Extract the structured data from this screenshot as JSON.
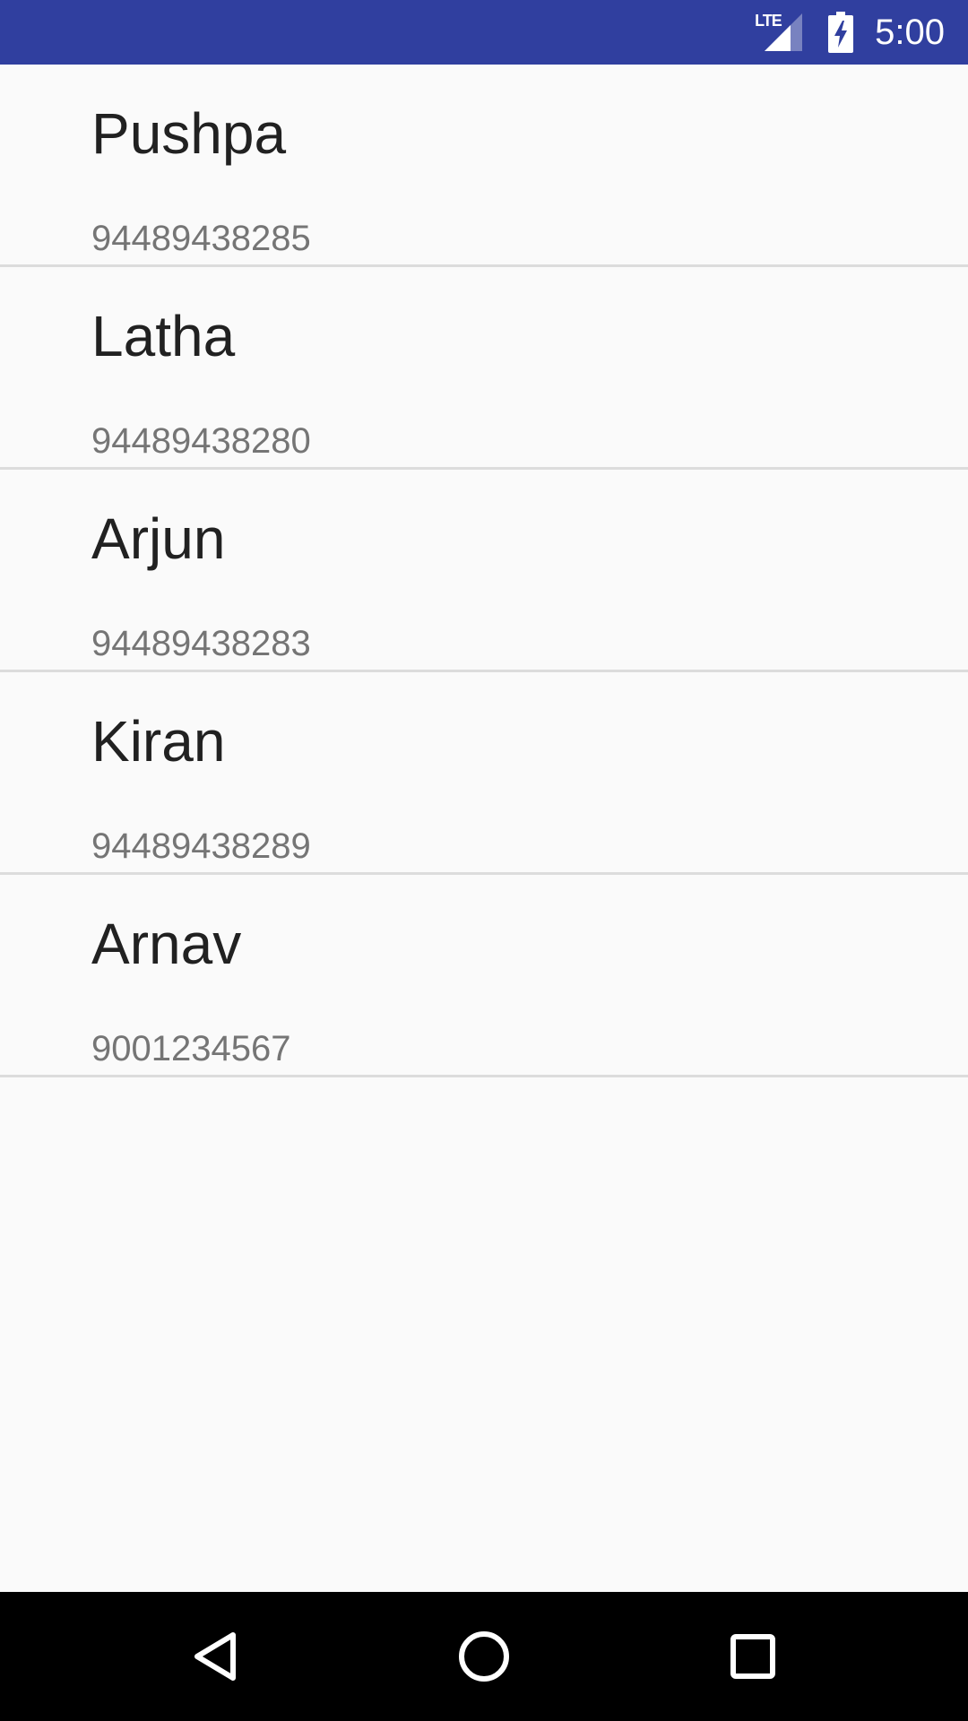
{
  "status_bar": {
    "network_label": "LTE",
    "time": "5:00",
    "background_color": "#303F9F",
    "icons": [
      "lte-signal-icon",
      "battery-charging-icon"
    ]
  },
  "contacts": [
    {
      "name": "Pushpa",
      "phone": "94489438285"
    },
    {
      "name": "Latha",
      "phone": "94489438280"
    },
    {
      "name": "Arjun",
      "phone": "94489438283"
    },
    {
      "name": "Kiran",
      "phone": "94489438289"
    },
    {
      "name": "Arnav",
      "phone": "9001234567"
    }
  ],
  "nav_bar": {
    "icons": [
      "back-icon",
      "home-icon",
      "recents-icon"
    ]
  }
}
